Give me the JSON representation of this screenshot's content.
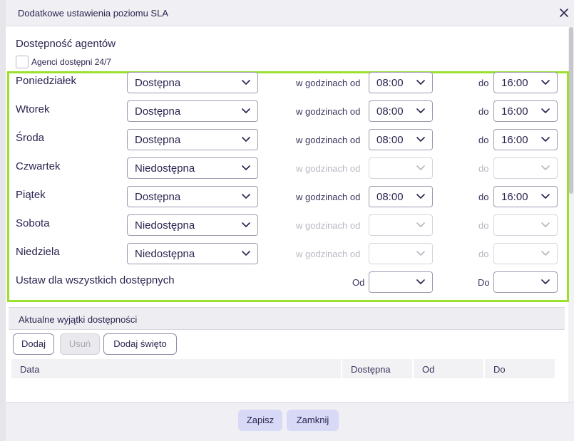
{
  "dialog": {
    "title": "Dodatkowe ustawienia poziomu SLA",
    "section_heading": "Dostępność agentów",
    "always_available_label": "Agenci dostępni 24/7",
    "always_available_checked": false
  },
  "labels": {
    "hours_from": "w godzinach od",
    "to": "do"
  },
  "days": [
    {
      "name": "Poniedziałek",
      "status": "Dostępna",
      "from": "08:00",
      "to": "16:00"
    },
    {
      "name": "Wtorek",
      "status": "Dostępna",
      "from": "08:00",
      "to": "16:00"
    },
    {
      "name": "Środa",
      "status": "Dostępna",
      "from": "08:00",
      "to": "16:00"
    },
    {
      "name": "Czwartek",
      "status": "Niedostępna",
      "from": "",
      "to": ""
    },
    {
      "name": "Piątek",
      "status": "Dostępna",
      "from": "08:00",
      "to": "16:00"
    },
    {
      "name": "Sobota",
      "status": "Niedostępna",
      "from": "",
      "to": ""
    },
    {
      "name": "Niedziela",
      "status": "Niedostępna",
      "from": "",
      "to": ""
    }
  ],
  "set_all": {
    "label": "Ustaw dla wszystkich dostępnych",
    "from_label": "Od",
    "to_label": "Do",
    "from": "",
    "to": ""
  },
  "exceptions": {
    "title": "Aktualne wyjątki dostępności",
    "buttons": {
      "add": "Dodaj",
      "remove": "Usuń",
      "add_holiday": "Dodaj święto"
    },
    "columns": [
      "Data",
      "Dostępna",
      "Od",
      "Do"
    ]
  },
  "footer": {
    "save": "Zapisz",
    "close": "Zamknij"
  },
  "colors": {
    "highlight": "#9be02c",
    "primary_text": "#2b2550",
    "footer_button": "#d7d9f6"
  }
}
